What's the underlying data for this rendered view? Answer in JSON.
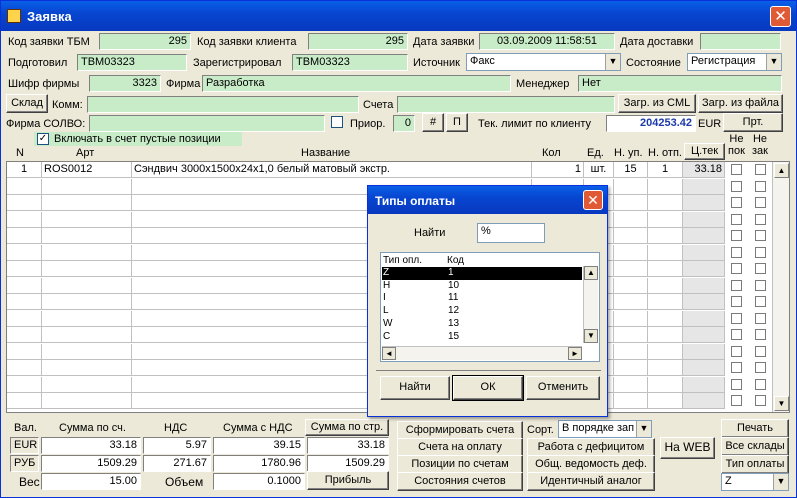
{
  "window": {
    "title": "Заявка"
  },
  "header": {
    "tbm_code_label": "Код заявки ТБМ",
    "tbm_code": "295",
    "client_code_label": "Код заявки клиента",
    "client_code": "295",
    "date_label": "Дата заявки",
    "date": "03.09.2009 11:58:51",
    "delivery_label": "Дата доставки",
    "delivery": "",
    "prepared_label": "Подготовил",
    "prepared": "TBM03323",
    "registered_label": "Зарегистрировал",
    "registered": "TBM03323",
    "source_label": "Источник",
    "source": "Факс",
    "state_label": "Состояние",
    "state": "Регистрация",
    "firm_code_label": "Шифр фирмы",
    "firm_code": "3323",
    "firm_label": "Фирма",
    "firm": "Разработка",
    "manager_label": "Менеджер",
    "manager": "Нет",
    "warehouse_btn": "Склад",
    "comment_label": "Комм:",
    "comment": "",
    "accounts_label": "Счета",
    "accounts": "",
    "load_cml": "Загр. из CML",
    "load_file": "Загр. из файла",
    "solvo_label": "Фирма СОЛВО:",
    "solvo": "",
    "prior_label": "Приор.",
    "prior": "0",
    "hash_btn": "#",
    "p_btn": "П",
    "limit_label": "Тек. лимит по клиенту",
    "limit": "204253.42",
    "limit_cur": "EUR",
    "prt_btn": "Прт.",
    "include_empty": "Включать в счет пустые позиции",
    "include_empty_checked": "✓"
  },
  "grid": {
    "columns": {
      "n": "N",
      "art": "Арт",
      "name": "Название",
      "qty": "Кол",
      "unit": "Ед.",
      "n_up": "Н. уп.",
      "n_otp": "Н. отп.",
      "price": "Ц.тек",
      "ne_pok": "Не\nпок",
      "ne_zak": "Не\nзак"
    },
    "rows": [
      {
        "n": "1",
        "art": "ROS0012",
        "name": "Сэндвич 3000х1500х24х1,0  белый матовый экстр.",
        "qty": "1",
        "unit": "шт.",
        "n_up": "15",
        "n_otp": "1",
        "price": "33.18"
      }
    ]
  },
  "totals": {
    "val_label": "Вал.",
    "sum_label": "Сумма по сч.",
    "nds_label": "НДС",
    "sum_nds_label": "Сумма с НДС",
    "sum_str_label": "Сумма по стр.",
    "eur": {
      "cur": "EUR",
      "sum": "33.18",
      "nds": "5.97",
      "sum_nds": "39.15",
      "sum_str": "33.18"
    },
    "rub": {
      "cur": "РУБ",
      "sum": "1509.29",
      "nds": "271.67",
      "sum_nds": "1780.96",
      "sum_str": "1509.29"
    },
    "weight_label": "Вес",
    "weight": "15.00",
    "volume_label": "Объем",
    "volume": "0.1000",
    "profit_btn": "Прибыль"
  },
  "actions": {
    "form_accounts": "Сформировать счета",
    "accounts_pay": "Счета на оплату",
    "positions": "Позиции по счетам",
    "states": "Состояния счетов",
    "sort_label": "Сорт.",
    "sort_value": "В порядке зап",
    "deficit": "Работа с дефицитом",
    "summary": "Общ. ведомость деф.",
    "analog": "Идентичный аналог",
    "web": "На WEB",
    "print": "Печать",
    "all_wh": "Все склады",
    "payment_type_label": "Тип оплаты",
    "payment_type_value": "Z"
  },
  "dialog": {
    "title": "Типы оплаты",
    "find_label": "Найти",
    "find_value": "%",
    "col_type": "Тип опл.",
    "col_code": "Код",
    "items": [
      {
        "type": "Z",
        "code": "1"
      },
      {
        "type": "H",
        "code": "10"
      },
      {
        "type": "I",
        "code": "11"
      },
      {
        "type": "L",
        "code": "12"
      },
      {
        "type": "W",
        "code": "13"
      },
      {
        "type": "C",
        "code": "15"
      }
    ],
    "find_btn": "Найти",
    "ok_btn": "ОК",
    "cancel_btn": "Отменить"
  }
}
